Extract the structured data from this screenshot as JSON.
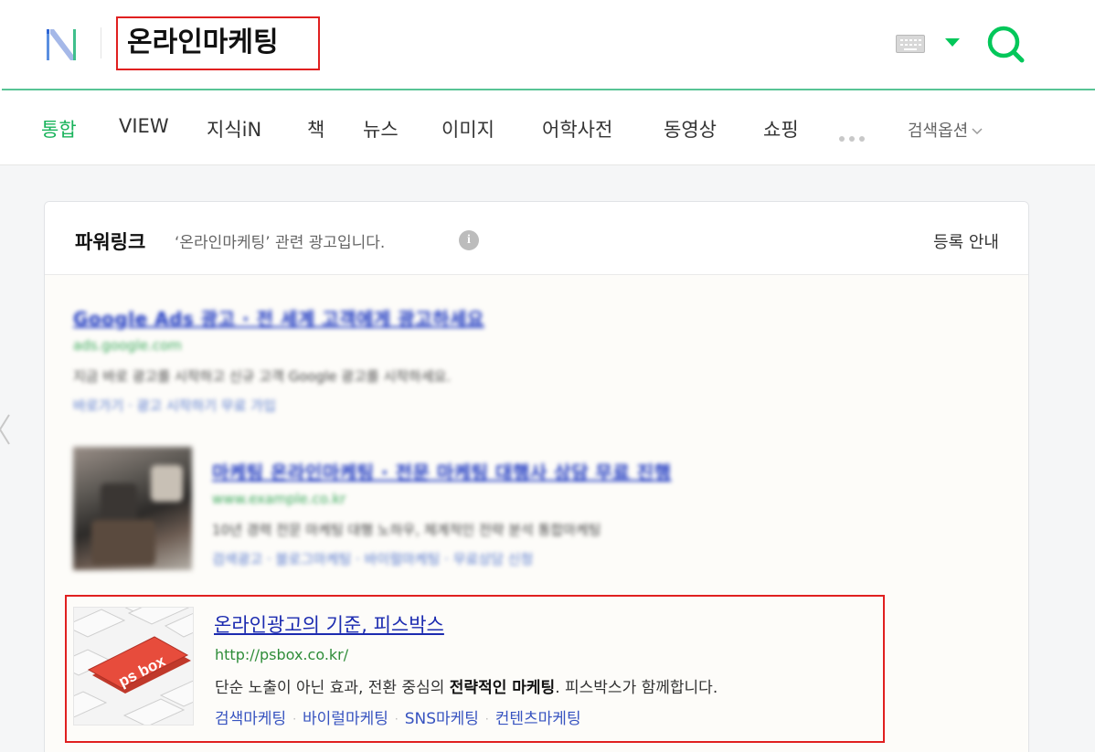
{
  "header": {
    "search_query": "온라인마케팅",
    "icons": [
      "naver-logo-icon",
      "keyboard-icon",
      "dropdown-caret-icon",
      "search-icon"
    ],
    "accent_color": "#03c75a"
  },
  "tabs": [
    {
      "label": "통합",
      "active": true
    },
    {
      "label": "VIEW"
    },
    {
      "label": "지식iN"
    },
    {
      "label": "책"
    },
    {
      "label": "뉴스"
    },
    {
      "label": "이미지"
    },
    {
      "label": "어학사전"
    },
    {
      "label": "동영상"
    },
    {
      "label": "쇼핑"
    }
  ],
  "search_options_label": "검색옵션",
  "powerlink": {
    "title": "파워링크",
    "desc": "‘온라인마케팅’ 관련 광고입니다.",
    "register": "등록 안내"
  },
  "blurred_ads": [
    {
      "title": "Google Ads 광고 · 전 세계 고객에게 광고하세요",
      "url": "ads.google.com",
      "desc": "지금 바로 광고를 시작하고 신규 고객 Google 광고를 시작하세요.",
      "links": "바로가기 · 광고 시작하기 무료 가입"
    },
    {
      "title": "마케팅 온라인마케팅 · 전문 마케팅 대행사 상담 무료 진행",
      "url": "www.example.co.kr",
      "desc": "10년 경력 전문 마케팅 대행 노하우, 체계적인 전략 분석 통합마케팅",
      "links": "검색광고 · 블로그마케팅 · 바이럴마케팅 · 무료상담 신청"
    }
  ],
  "ad": {
    "title": "온라인광고의 기준, 피스박스",
    "url": "http://psbox.co.kr/",
    "desc_pre": "단순 노출이 아닌 효과, 전환 중심의 ",
    "desc_bold": "전략적인 마케팅",
    "desc_post": ". 피스박스가 함께합니다.",
    "thumb_key_text": "ps box",
    "links": [
      "검색마케팅",
      "바이럴마케팅",
      "SNS마케팅",
      "컨텐츠마케팅"
    ]
  },
  "highlight_color": "#e02020"
}
